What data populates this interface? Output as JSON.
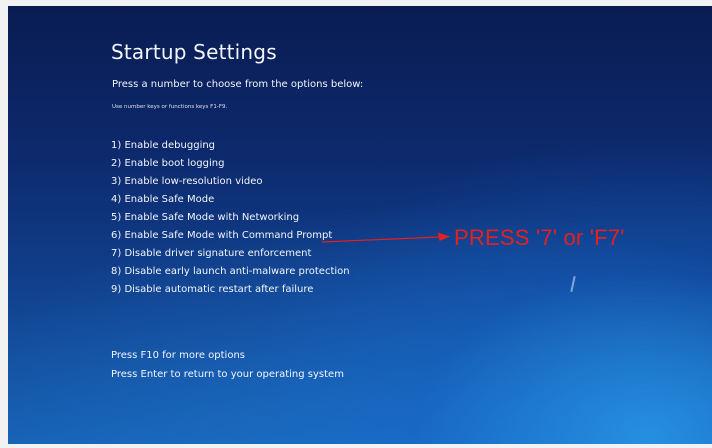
{
  "screen": {
    "title": "Startup Settings",
    "subtitle": "Press a number to choose from the options below:",
    "hint": "Use number keys or functions keys F1-F9.",
    "options": [
      "1) Enable debugging",
      "2) Enable boot logging",
      "3) Enable low-resolution video",
      "4) Enable Safe Mode",
      "5) Enable Safe Mode with Networking",
      "6) Enable Safe Mode with Command Prompt",
      "7) Disable driver signature enforcement",
      "8) Disable early launch anti-malware protection",
      "9) Disable automatic restart after failure"
    ],
    "footer_more": "Press F10 for more options",
    "footer_return": "Press Enter to return to your operating system"
  },
  "annotation": {
    "text": "PRESS '7' or 'F7'",
    "color": "#e5201d"
  },
  "colors": {
    "screen_top": "#0a1c52",
    "screen_bottom": "#1761b3",
    "text": "#f2f5fb"
  }
}
